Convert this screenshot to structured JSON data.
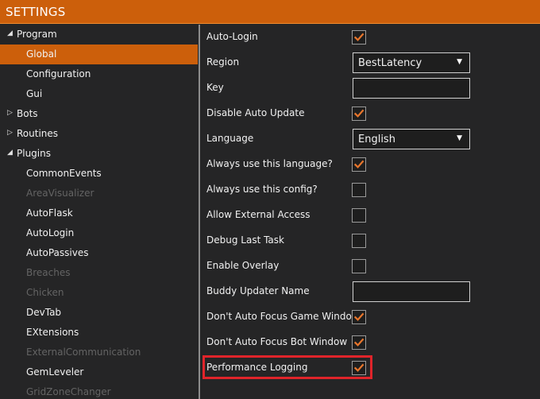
{
  "window": {
    "title": "SETTINGS"
  },
  "colors": {
    "accent": "#cc5f0b",
    "check": "#e8762c",
    "highlight": "#e0242a"
  },
  "sidebar": {
    "items": [
      {
        "label": "Program",
        "level": 0,
        "expanded": true,
        "selected": false,
        "disabled": false
      },
      {
        "label": "Global",
        "level": 1,
        "selected": true,
        "disabled": false
      },
      {
        "label": "Configuration",
        "level": 1,
        "selected": false,
        "disabled": false
      },
      {
        "label": "Gui",
        "level": 1,
        "selected": false,
        "disabled": false
      },
      {
        "label": "Bots",
        "level": 0,
        "expanded": false,
        "selected": false,
        "disabled": false
      },
      {
        "label": "Routines",
        "level": 0,
        "expanded": false,
        "selected": false,
        "disabled": false
      },
      {
        "label": "Plugins",
        "level": 0,
        "expanded": true,
        "selected": false,
        "disabled": false
      },
      {
        "label": "CommonEvents",
        "level": 1,
        "selected": false,
        "disabled": false
      },
      {
        "label": "AreaVisualizer",
        "level": 1,
        "selected": false,
        "disabled": true
      },
      {
        "label": "AutoFlask",
        "level": 1,
        "selected": false,
        "disabled": false
      },
      {
        "label": "AutoLogin",
        "level": 1,
        "selected": false,
        "disabled": false
      },
      {
        "label": "AutoPassives",
        "level": 1,
        "selected": false,
        "disabled": false
      },
      {
        "label": "Breaches",
        "level": 1,
        "selected": false,
        "disabled": true
      },
      {
        "label": "Chicken",
        "level": 1,
        "selected": false,
        "disabled": true
      },
      {
        "label": "DevTab",
        "level": 1,
        "selected": false,
        "disabled": false
      },
      {
        "label": "EXtensions",
        "level": 1,
        "selected": false,
        "disabled": false
      },
      {
        "label": "ExternalCommunication",
        "level": 1,
        "selected": false,
        "disabled": true
      },
      {
        "label": "GemLeveler",
        "level": 1,
        "selected": false,
        "disabled": false
      },
      {
        "label": "GridZoneChanger",
        "level": 1,
        "selected": false,
        "disabled": true
      }
    ]
  },
  "settings": [
    {
      "label": "Auto-Login",
      "control": "checkbox",
      "checked": true
    },
    {
      "label": "Region",
      "control": "combo",
      "value": "BestLatency"
    },
    {
      "label": "Key",
      "control": "text",
      "value": ""
    },
    {
      "label": "Disable Auto Update",
      "control": "checkbox",
      "checked": true
    },
    {
      "label": "Language",
      "control": "combo",
      "value": "English"
    },
    {
      "label": "Always use this language?",
      "control": "checkbox",
      "checked": true
    },
    {
      "label": "Always use this config?",
      "control": "checkbox",
      "checked": false
    },
    {
      "label": "Allow External Access",
      "control": "checkbox",
      "checked": false
    },
    {
      "label": "Debug Last Task",
      "control": "checkbox",
      "checked": false
    },
    {
      "label": "Enable Overlay",
      "control": "checkbox",
      "checked": false
    },
    {
      "label": "Buddy Updater Name",
      "control": "text",
      "value": ""
    },
    {
      "label": "Don't Auto Focus Game Window",
      "control": "checkbox",
      "checked": true
    },
    {
      "label": "Don't Auto Focus Bot Window",
      "control": "checkbox",
      "checked": true
    },
    {
      "label": "Performance Logging",
      "control": "checkbox",
      "checked": true,
      "highlighted": true
    }
  ]
}
